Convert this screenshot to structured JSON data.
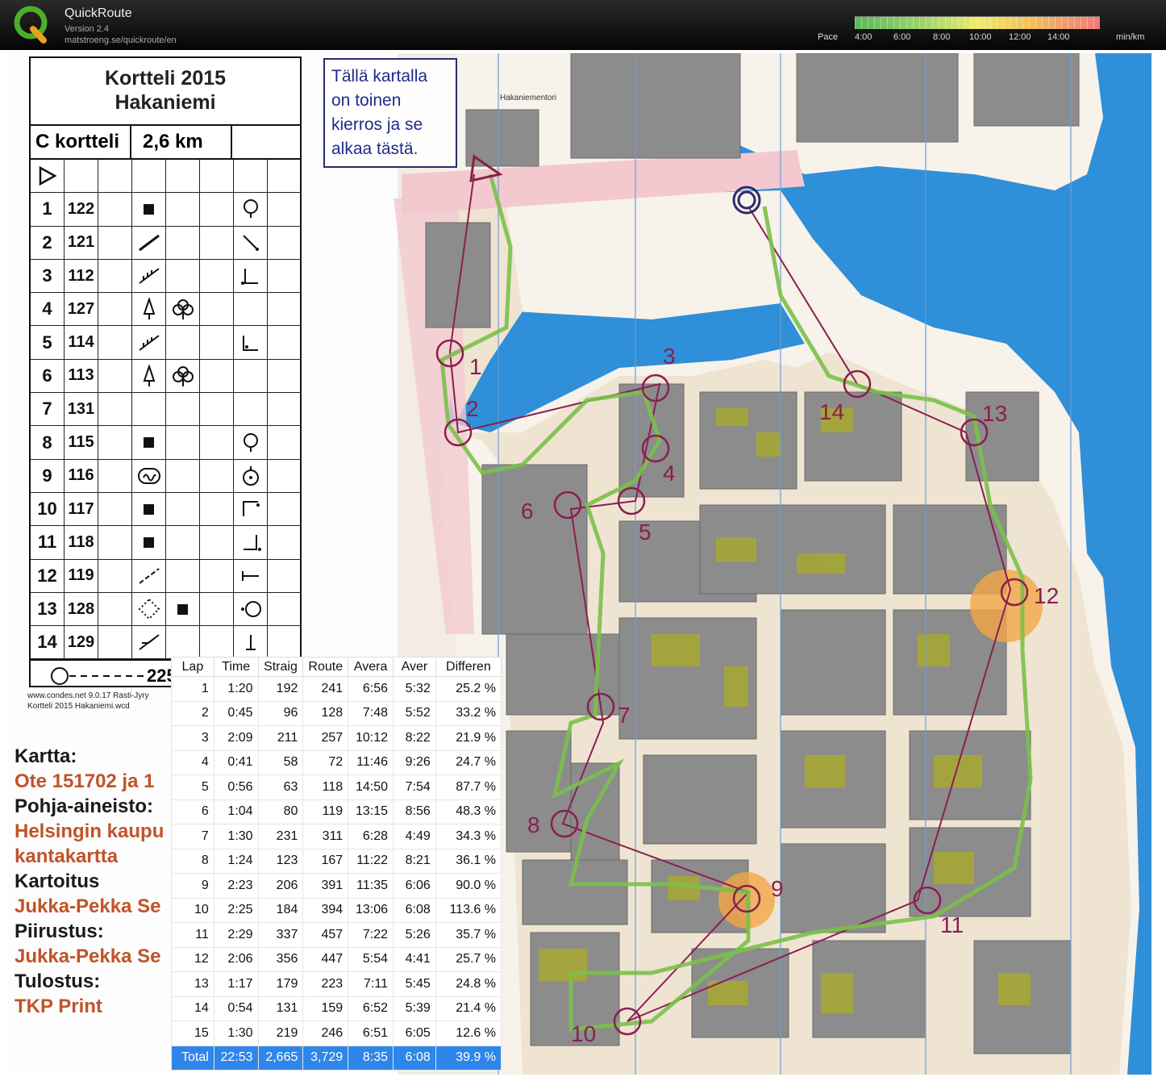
{
  "app": {
    "name": "QuickRoute",
    "version": "Version 2.4",
    "url": "matstroeng.se/quickroute/en"
  },
  "pace_legend": {
    "label": "Pace",
    "ticks": [
      "4:00",
      "6:00",
      "8:00",
      "10:00",
      "12:00",
      "14:00"
    ],
    "unit": "min/km",
    "colors": [
      "#5cb85c",
      "#9fd46a",
      "#ecec6a",
      "#f2c45a",
      "#f07a7a"
    ]
  },
  "description_sheet": {
    "title_line1": "Kortteli 2015",
    "title_line2": "Hakaniemi",
    "class": "C kortteli",
    "length": "2,6 km",
    "controls": [
      {
        "num": "1",
        "code": "122"
      },
      {
        "num": "2",
        "code": "121"
      },
      {
        "num": "3",
        "code": "112"
      },
      {
        "num": "4",
        "code": "127"
      },
      {
        "num": "5",
        "code": "114"
      },
      {
        "num": "6",
        "code": "113"
      },
      {
        "num": "7",
        "code": "131"
      },
      {
        "num": "8",
        "code": "115"
      },
      {
        "num": "9",
        "code": "116"
      },
      {
        "num": "10",
        "code": "117"
      },
      {
        "num": "11",
        "code": "118"
      },
      {
        "num": "12",
        "code": "119"
      },
      {
        "num": "13",
        "code": "128"
      },
      {
        "num": "14",
        "code": "129"
      }
    ],
    "finish": "225",
    "credit_line1": "www.condes.net 9.0.17 Rasti-Jyry",
    "credit_line2": "Kortteli 2015 Hakaniemi.wcd"
  },
  "map_info": {
    "kartta_label": "Kartta:",
    "kartta_value": "Ote 151702 ja 1",
    "pohja_label": "Pohja-aineisto:",
    "pohja_value1": "Helsingin kaupu",
    "pohja_value2": "kantakartta",
    "kartoitus_label": "Kartoitus",
    "kartoitus_value": "Jukka-Pekka Se",
    "piirustus_label": "Piirustus:",
    "piirustus_value": "Jukka-Pekka Se",
    "tulostus_label": "Tulostus:",
    "tulostus_value": "TKP Print"
  },
  "notice": {
    "lines": [
      "Tällä kartalla",
      "on toinen",
      "kierros ja se",
      "alkaa tästä."
    ]
  },
  "map_labels": {
    "street": "Hakaniementori"
  },
  "control_labels": [
    "1",
    "2",
    "3",
    "4",
    "5",
    "6",
    "7",
    "8",
    "9",
    "10",
    "11",
    "12",
    "13",
    "14"
  ],
  "lap_table": {
    "headers": [
      "Lap",
      "Time",
      "Straig",
      "Route",
      "Avera",
      "Aver",
      "Differen"
    ],
    "rows": [
      [
        "1",
        "1:20",
        "192",
        "241",
        "6:56",
        "5:32",
        "25.2 %"
      ],
      [
        "2",
        "0:45",
        "96",
        "128",
        "7:48",
        "5:52",
        "33.2 %"
      ],
      [
        "3",
        "2:09",
        "211",
        "257",
        "10:12",
        "8:22",
        "21.9 %"
      ],
      [
        "4",
        "0:41",
        "58",
        "72",
        "11:46",
        "9:26",
        "24.7 %"
      ],
      [
        "5",
        "0:56",
        "63",
        "118",
        "14:50",
        "7:54",
        "87.7 %"
      ],
      [
        "6",
        "1:04",
        "80",
        "119",
        "13:15",
        "8:56",
        "48.3 %"
      ],
      [
        "7",
        "1:30",
        "231",
        "311",
        "6:28",
        "4:49",
        "34.3 %"
      ],
      [
        "8",
        "1:24",
        "123",
        "167",
        "11:22",
        "8:21",
        "36.1 %"
      ],
      [
        "9",
        "2:23",
        "206",
        "391",
        "11:35",
        "6:06",
        "90.0 %"
      ],
      [
        "10",
        "2:25",
        "184",
        "394",
        "13:06",
        "6:08",
        "113.6 %"
      ],
      [
        "11",
        "2:29",
        "337",
        "457",
        "7:22",
        "5:26",
        "35.7 %"
      ],
      [
        "12",
        "2:06",
        "356",
        "447",
        "5:54",
        "4:41",
        "25.7 %"
      ],
      [
        "13",
        "1:17",
        "179",
        "223",
        "7:11",
        "5:45",
        "24.8 %"
      ],
      [
        "14",
        "0:54",
        "131",
        "159",
        "6:52",
        "5:39",
        "21.4 %"
      ],
      [
        "15",
        "1:30",
        "219",
        "246",
        "6:51",
        "6:05",
        "12.6 %"
      ]
    ],
    "total": [
      "Total",
      "22:53",
      "2,665",
      "3,729",
      "8:35",
      "6:08",
      "39.9 %"
    ]
  }
}
